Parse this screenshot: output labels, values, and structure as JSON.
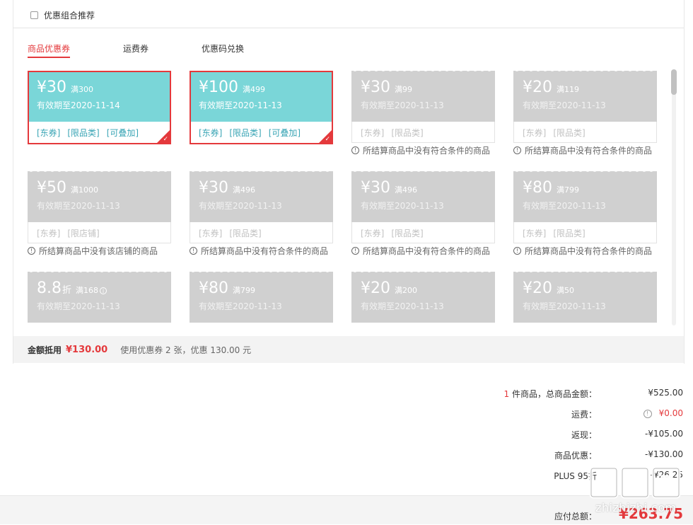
{
  "combo": {
    "label": "优惠组合推荐",
    "checked": false
  },
  "tabs": [
    {
      "label": "商品优惠券",
      "active": true
    },
    {
      "label": "运费券",
      "active": false
    },
    {
      "label": "优惠码兑换",
      "active": false
    }
  ],
  "coupons": [
    {
      "amount": "¥30",
      "condition": "满300",
      "expiry": "有效期至2020-11-14",
      "tags": [
        "[东券]",
        "[限品类]",
        "[可叠加]"
      ],
      "state": "selected",
      "note": ""
    },
    {
      "amount": "¥100",
      "condition": "满499",
      "expiry": "有效期至2020-11-13",
      "tags": [
        "[东券]",
        "[限品类]",
        "[可叠加]"
      ],
      "state": "selected",
      "note": ""
    },
    {
      "amount": "¥30",
      "condition": "满99",
      "expiry": "有效期至2020-11-13",
      "tags": [
        "[东券]",
        "[限品类]"
      ],
      "state": "disabled",
      "note": "所结算商品中没有符合条件的商品"
    },
    {
      "amount": "¥20",
      "condition": "满119",
      "expiry": "有效期至2020-11-13",
      "tags": [
        "[东券]",
        "[限品类]"
      ],
      "state": "disabled",
      "note": "所结算商品中没有符合条件的商品"
    },
    {
      "amount": "¥50",
      "condition": "满1000",
      "expiry": "有效期至2020-11-13",
      "tags": [
        "[东券]",
        "[限店铺]"
      ],
      "state": "disabled",
      "note": "所结算商品中没有该店铺的商品"
    },
    {
      "amount": "¥30",
      "condition": "满496",
      "expiry": "有效期至2020-11-13",
      "tags": [
        "[东券]",
        "[限品类]"
      ],
      "state": "disabled",
      "note": "所结算商品中没有符合条件的商品"
    },
    {
      "amount": "¥30",
      "condition": "满496",
      "expiry": "有效期至2020-11-13",
      "tags": [
        "[东券]",
        "[限品类]"
      ],
      "state": "disabled",
      "note": "所结算商品中没有符合条件的商品"
    },
    {
      "amount": "¥80",
      "condition": "满799",
      "expiry": "有效期至2020-11-13",
      "tags": [
        "[东券]",
        "[限品类]"
      ],
      "state": "disabled",
      "note": "所结算商品中没有符合条件的商品"
    },
    {
      "amount": "8.8",
      "unit": "折",
      "condition": "满168",
      "expiry": "有效期至2020-11-13",
      "tags": [],
      "state": "disabled",
      "note": "",
      "has_info": true
    },
    {
      "amount": "¥80",
      "condition": "满799",
      "expiry": "有效期至2020-11-13",
      "tags": [],
      "state": "disabled",
      "note": ""
    },
    {
      "amount": "¥20",
      "condition": "满200",
      "expiry": "有效期至2020-11-13",
      "tags": [],
      "state": "disabled",
      "note": ""
    },
    {
      "amount": "¥20",
      "condition": "满50",
      "expiry": "有效期至2020-11-13",
      "tags": [],
      "state": "disabled",
      "note": ""
    }
  ],
  "summary": {
    "label": "金额抵用",
    "amount": "¥130.00",
    "description": "使用优惠券 2 张，优惠 130.00 元"
  },
  "totals": {
    "items_count": "1",
    "items_label": "件商品，总商品金额：",
    "items_value": "¥525.00",
    "freight_label": "运费：",
    "freight_value": "¥0.00",
    "rebate_label": "返现：",
    "rebate_value": "-¥105.00",
    "discount_label": "商品优惠：",
    "discount_value": "-¥130.00",
    "plus_label": "PLUS 95折",
    "plus_value": "-¥26.25"
  },
  "payable": {
    "label": "应付总额：",
    "value": "¥263.75"
  },
  "watermark": {
    "text": "zhizhizhi.com"
  },
  "colors": {
    "accent": "#e4393c",
    "coupon_active": "#7ad6d8",
    "coupon_disabled": "#d0d0d0",
    "tag_active": "#3aa5b5"
  }
}
